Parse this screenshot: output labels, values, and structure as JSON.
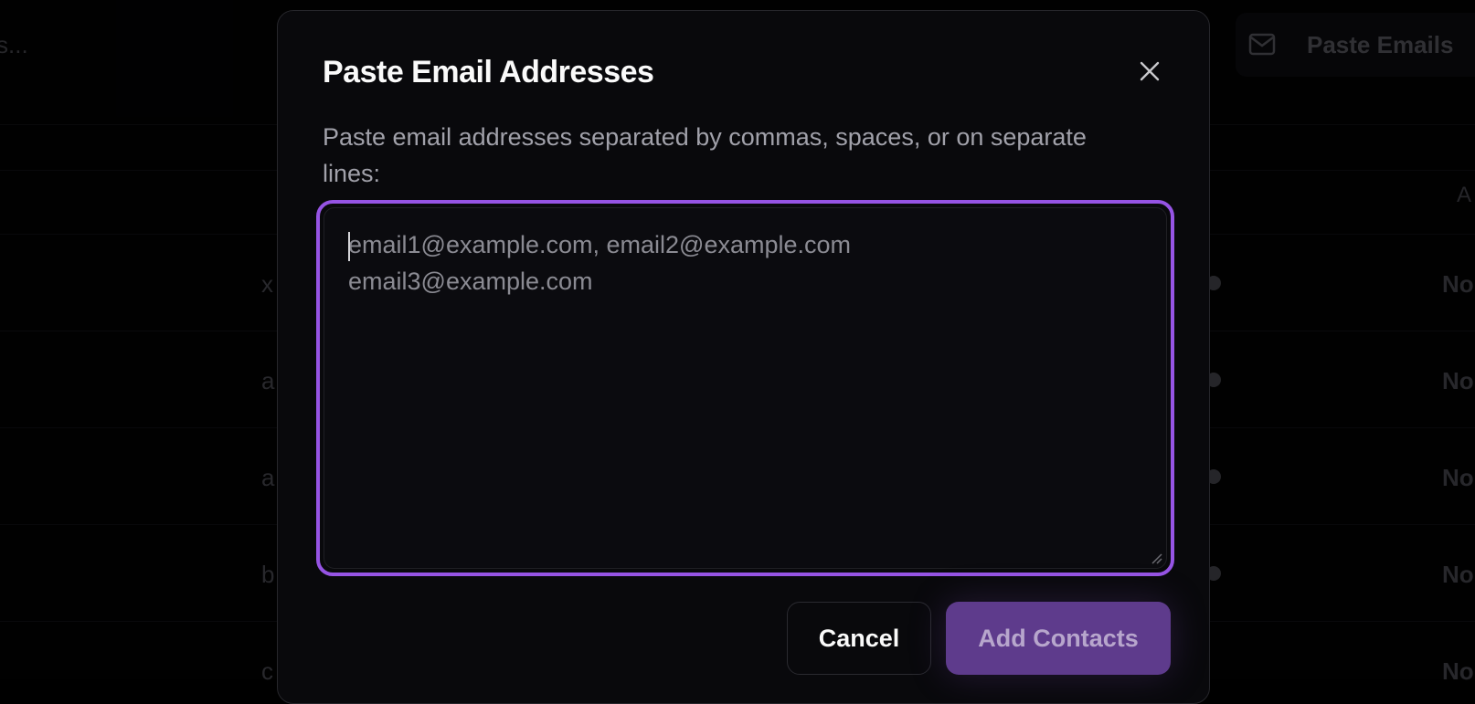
{
  "background": {
    "search_placeholder_fragment": "s...",
    "paste_button_label": "Paste Emails",
    "paste_button_icon": "mail-icon",
    "column_header_fragment": "A",
    "rows": [
      {
        "letter": "x",
        "status": "No"
      },
      {
        "letter": "a",
        "status": "No"
      },
      {
        "letter": "a",
        "status": "No"
      },
      {
        "letter": "b",
        "status": "No"
      },
      {
        "letter": "c",
        "status": "No"
      }
    ]
  },
  "modal": {
    "title": "Paste Email Addresses",
    "close_icon": "close-icon",
    "description": "Paste email addresses separated by commas, spaces, or on separate lines:",
    "textarea": {
      "value": "",
      "placeholder": "email1@example.com, email2@example.com\nemail3@example.com"
    },
    "cancel_label": "Cancel",
    "submit_label": "Add Contacts"
  },
  "colors": {
    "accent": "#9654e4",
    "submit_bg": "#5e3b8c",
    "modal_bg": "#09090c"
  }
}
